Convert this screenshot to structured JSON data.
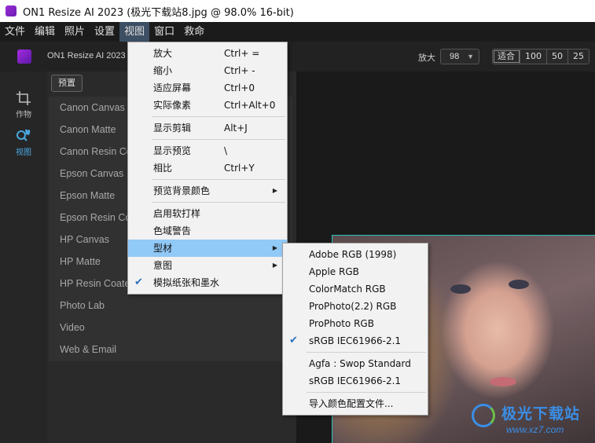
{
  "window": {
    "title": "ON1 Resize AI 2023 (极光下载站8.jpg @ 98.0% 16-bit)"
  },
  "menubar": {
    "items": [
      "文件",
      "编辑",
      "照片",
      "设置",
      "视图",
      "窗口",
      "救命"
    ],
    "active_index": 4
  },
  "toolbar": {
    "product_name": "ON1 Resize AI 2023",
    "zoom_label": "放大",
    "zoom_value": "98",
    "zoom_buttons": [
      "适合",
      "100",
      "50",
      "25"
    ]
  },
  "rail": {
    "items": [
      {
        "label": "作物",
        "icon": "crop-icon"
      },
      {
        "label": "视图",
        "icon": "zoom-hand-icon"
      }
    ]
  },
  "panel": {
    "preset_button": "预置",
    "presets": [
      "Canon Canvas",
      "Canon Matte",
      "Canon Resin Coated",
      "Epson Canvas",
      "Epson Matte",
      "Epson Resin Coated",
      "HP Canvas",
      "HP Matte",
      "HP Resin Coated",
      "Photo Lab",
      "Video",
      "Web & Email"
    ]
  },
  "view_menu": {
    "groups": [
      [
        {
          "label": "放大",
          "shortcut": "Ctrl+ ="
        },
        {
          "label": "缩小",
          "shortcut": "Ctrl+ -"
        },
        {
          "label": "适应屏幕",
          "shortcut": "Ctrl+0"
        },
        {
          "label": "实际像素",
          "shortcut": "Ctrl+Alt+0"
        }
      ],
      [
        {
          "label": "显示剪辑",
          "shortcut": "Alt+J"
        }
      ],
      [
        {
          "label": "显示预览",
          "shortcut": "\\"
        },
        {
          "label": "相比",
          "shortcut": "Ctrl+Y"
        }
      ],
      [
        {
          "label": "预览背景颜色",
          "shortcut": "",
          "submenu": true
        }
      ],
      [
        {
          "label": "启用软打样",
          "shortcut": ""
        },
        {
          "label": "色域警告",
          "shortcut": ""
        },
        {
          "label": "型材",
          "shortcut": "",
          "submenu": true,
          "highlighted": true
        },
        {
          "label": "意图",
          "shortcut": "",
          "submenu": true
        },
        {
          "label": "模拟纸张和墨水",
          "shortcut": "",
          "checked": true
        }
      ]
    ]
  },
  "profile_submenu": {
    "groups": [
      [
        {
          "label": "Adobe RGB (1998)"
        },
        {
          "label": "Apple RGB"
        },
        {
          "label": "ColorMatch RGB"
        },
        {
          "label": "ProPhoto(2.2) RGB"
        },
        {
          "label": "ProPhoto RGB"
        },
        {
          "label": "sRGB IEC61966-2.1",
          "checked": true
        }
      ],
      [
        {
          "label": "Agfa : Swop Standard"
        },
        {
          "label": "sRGB IEC61966-2.1"
        }
      ],
      [
        {
          "label": "导入颜色配置文件..."
        }
      ]
    ]
  },
  "watermark": {
    "text": "极光下载站",
    "url": "www.xz7.com"
  },
  "colors": {
    "menu_highlight": "#91c9f7",
    "check": "#2a6fbf",
    "accent": "#4aa8e0",
    "canvas_border": "#2cc0b8"
  }
}
